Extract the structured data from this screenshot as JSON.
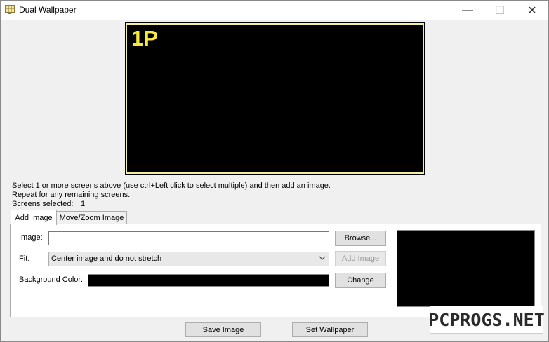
{
  "window": {
    "title": "Dual Wallpaper",
    "minimize_glyph": "—",
    "maximize_glyph": "☐",
    "close_glyph": "✕"
  },
  "preview": {
    "screen_label": "1P"
  },
  "instructions": {
    "line1": "Select 1 or more screens above (use ctrl+Left click to select multiple) and then add an image.",
    "line2": "Repeat for any remaining screens.",
    "screens_selected_label": "Screens selected:",
    "screens_selected_count": "1"
  },
  "tabs": [
    {
      "label": "Add Image",
      "active": true
    },
    {
      "label": "Move/Zoom Image",
      "active": false
    }
  ],
  "form": {
    "image_label": "Image:",
    "image_value": "",
    "browse_label": "Browse...",
    "fit_label": "Fit:",
    "fit_value": "Center image and do not stretch",
    "add_image_label": "Add Image",
    "bg_color_label": "Background Color:",
    "bg_color": "#000000",
    "change_label": "Change"
  },
  "footer": {
    "save_label": "Save Image",
    "set_label": "Set Wallpaper"
  },
  "watermark": {
    "text": "PCPROGS.NET"
  },
  "colors": {
    "screen_border": "#f3ef9e",
    "screen_label": "#f5ea3c"
  }
}
